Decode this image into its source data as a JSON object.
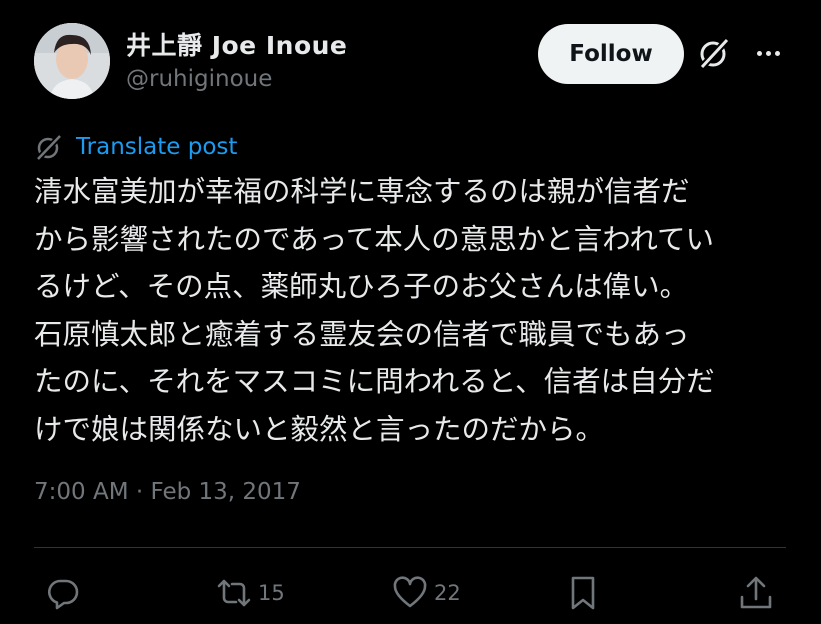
{
  "author": {
    "display_name": "井上靜 Joe Inoue",
    "handle": "@ruhiginoue"
  },
  "header": {
    "follow_label": "Follow"
  },
  "post": {
    "translate_label": "Translate post",
    "text_lines": [
      "清水富美加が幸福の科学に専念するのは親が信者だ",
      "から影響されたのであって本人の意思かと言われてい",
      "るけど、その点、薬師丸ひろ子のお父さんは偉い。",
      "石原慎太郎と癒着する霊友会の信者で職員でもあっ",
      "たのに、それをマスコミに問われると、信者は自分だ",
      "けで娘は関係ないと毅然と言ったのだから。"
    ],
    "timestamp": "7:00 AM · Feb 13, 2017"
  },
  "actions": {
    "reply_icon": "reply-icon",
    "retweet_icon": "retweet-icon",
    "retweet_count": "15",
    "like_icon": "heart-icon",
    "like_count": "22",
    "bookmark_icon": "bookmark-icon",
    "share_icon": "share-icon"
  },
  "colors": {
    "background": "#000000",
    "text_primary": "#e7e9ea",
    "text_secondary": "#71767b",
    "link": "#1d9bf0",
    "follow_bg": "#eff3f4",
    "divider": "#2f3336"
  }
}
